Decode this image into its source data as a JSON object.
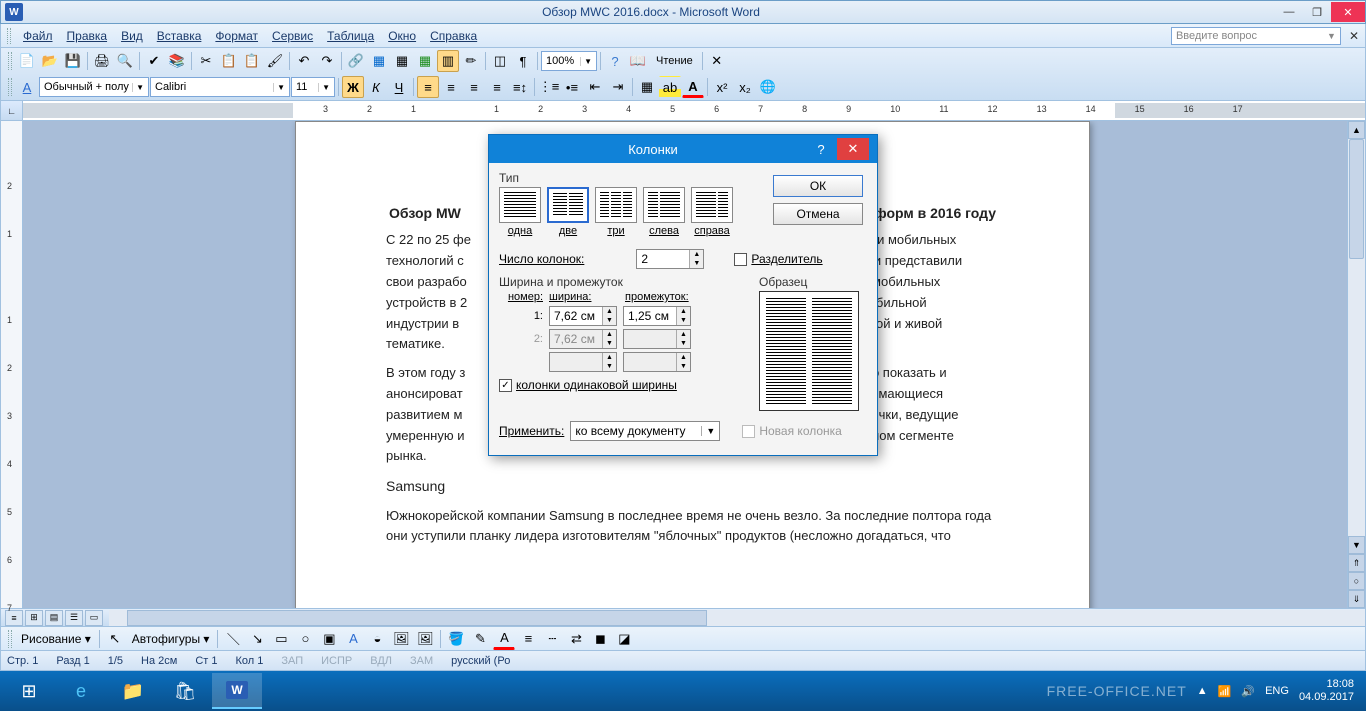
{
  "title": "Обзор MWC 2016.docx - Microsoft Word",
  "menu": [
    "Файл",
    "Правка",
    "Вид",
    "Вставка",
    "Формат",
    "Сервис",
    "Таблица",
    "Окно",
    "Справка"
  ],
  "questionBox": "Введите вопрос",
  "toolbar": {
    "style": "Обычный + полу",
    "font": "Calibri",
    "size": "11",
    "zoom": "100%",
    "reading": "Чтение"
  },
  "doc": {
    "heading_prefix": "Обзор MW",
    "heading_suffix": "латформ в 2016 году",
    "p1_left": "С 22 по 25 фе\nтехнологий с\nсвои разрабо\nустройств в 2\nиндустрии в\nтематике.",
    "p1_right": "ндустрии мобильных\nомпании представили\nонов и мобильных\nнтов мобильной\nктуальной и живой",
    "p2_left": "В этом году з\nанонсироват\nразвитием м\nумеренную и\nрынка.",
    "p2_right": "было что показать и\nемя занимающиеся\nнии-новички, ведущие\nасыщенном сегменте",
    "h2": "Samsung",
    "p3": "Южнокорейской компании Samsung в последнее время не очень везло. За последние полтора года они уступили планку лидера изготовителям \"яблочных\" продуктов (несложно догадаться, что"
  },
  "ruler_nums": [
    "1",
    "2",
    "1",
    "2",
    "3",
    "4",
    "5",
    "6",
    "7",
    "8",
    "9",
    "10",
    "11",
    "12",
    "13",
    "14",
    "15",
    "16",
    "17"
  ],
  "vruler_nums": [
    "2",
    "1",
    "",
    "1",
    "2",
    "3",
    "4",
    "5",
    "6",
    "7"
  ],
  "dialog": {
    "title": "Колонки",
    "presets_label": "Тип",
    "presets": [
      "одна",
      "две",
      "три",
      "слева",
      "справа"
    ],
    "num_label": "Число колонок:",
    "num_value": "2",
    "divider": "Разделитель",
    "width_group": "Ширина и промежуток",
    "hdr_num": "номер:",
    "hdr_width": "ширина:",
    "hdr_gap": "промежуток:",
    "row1_num": "1:",
    "row1_width": "7,62 см",
    "row1_gap": "1,25 см",
    "row2_num": "2:",
    "row2_width": "7,62 см",
    "row2_gap": "",
    "equal": "колонки одинаковой ширины",
    "apply_label": "Применить:",
    "apply_value": "ко всему документу",
    "new_column": "Новая колонка",
    "preview": "Образец",
    "ok": "ОК",
    "cancel": "Отмена"
  },
  "drawbar": {
    "draw": "Рисование",
    "autoshapes": "Автофигуры"
  },
  "status": {
    "page": "Стр. 1",
    "section": "Разд 1",
    "pages": "1/5",
    "at": "На 2см",
    "line": "Ст 1",
    "col": "Кол 1",
    "rec": "ЗАП",
    "trk": "ИСПР",
    "ext": "ВДЛ",
    "ovr": "ЗАМ",
    "lang": "русский (Ро"
  },
  "tray": {
    "lang": "ENG",
    "time": "18:08",
    "date": "04.09.2017",
    "watermark": "FREE-OFFICE.NET"
  }
}
